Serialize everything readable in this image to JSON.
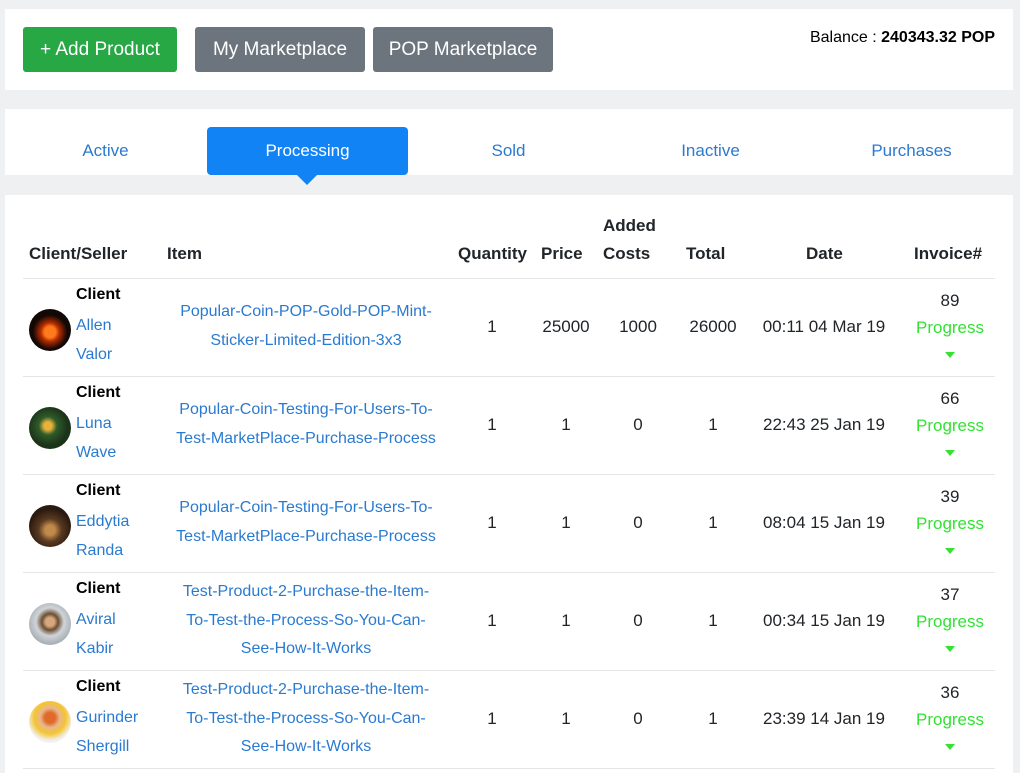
{
  "toolbar": {
    "add_label": "+ Add Product",
    "my_label": "My Marketplace",
    "pop_label": "POP Marketplace",
    "balance_label": "Balance :",
    "balance_value": "240343.32 POP"
  },
  "tabs": [
    {
      "label": "Active"
    },
    {
      "label": "Processing"
    },
    {
      "label": "Sold"
    },
    {
      "label": "Inactive"
    },
    {
      "label": "Purchases"
    }
  ],
  "table": {
    "headers": {
      "client": "Client/Seller",
      "item": "Item",
      "quantity": "Quantity",
      "price": "Price",
      "added1": "Added",
      "added2": "Costs",
      "total": "Total",
      "date": "Date",
      "invoice": "Invoice#"
    },
    "rows": [
      {
        "role": "Client",
        "first": "Allen",
        "last": "Valor",
        "item": [
          "Popular-Coin-POP-Gold-POP-Mint-",
          "Sticker-Limited-Edition-3x3"
        ],
        "qty": "1",
        "price": "25000",
        "added": "1000",
        "total": "26000",
        "date": "00:11 04 Mar 19",
        "invoice": "89",
        "status": "Progress"
      },
      {
        "role": "Client",
        "first": "Luna",
        "last": "Wave",
        "item": [
          "Popular-Coin-Testing-For-Users-To-",
          "Test-MarketPlace-Purchase-Process"
        ],
        "qty": "1",
        "price": "1",
        "added": "0",
        "total": "1",
        "date": "22:43 25 Jan 19",
        "invoice": "66",
        "status": "Progress"
      },
      {
        "role": "Client",
        "first": "Eddytia",
        "last": "Randa",
        "item": [
          "Popular-Coin-Testing-For-Users-To-",
          "Test-MarketPlace-Purchase-Process"
        ],
        "qty": "1",
        "price": "1",
        "added": "0",
        "total": "1",
        "date": "08:04 15 Jan 19",
        "invoice": "39",
        "status": "Progress"
      },
      {
        "role": "Client",
        "first": "Aviral",
        "last": "Kabir",
        "item": [
          "Test-Product-2-Purchase-the-Item-",
          "To-Test-the-Process-So-You-Can-",
          "See-How-It-Works"
        ],
        "qty": "1",
        "price": "1",
        "added": "0",
        "total": "1",
        "date": "00:34 15 Jan 19",
        "invoice": "37",
        "status": "Progress"
      },
      {
        "role": "Client",
        "first": "Gurinder",
        "last": "Shergill",
        "item": [
          "Test-Product-2-Purchase-the-Item-",
          "To-Test-the-Process-So-You-Can-",
          "See-How-It-Works"
        ],
        "qty": "1",
        "price": "1",
        "added": "0",
        "total": "1",
        "date": "23:39 14 Jan 19",
        "invoice": "36",
        "status": "Progress"
      }
    ]
  }
}
